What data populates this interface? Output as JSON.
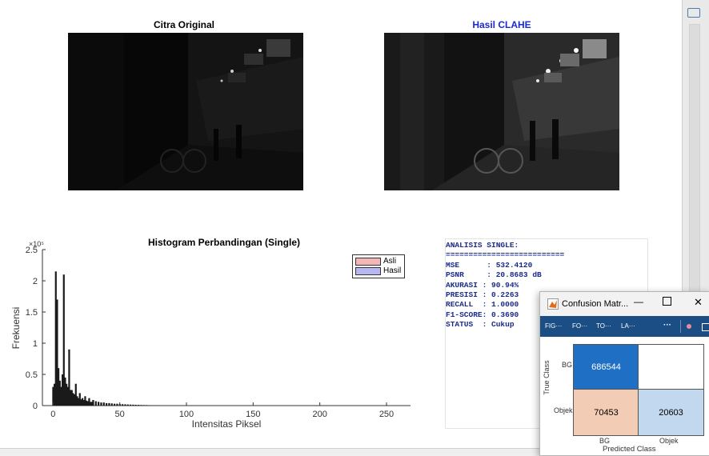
{
  "figure": {
    "title_original": "Citra Original",
    "title_clahe": "Hasil CLAHE",
    "title_clahe_color": "#1a2ad0"
  },
  "histogram": {
    "title": "Histogram Perbandingan (Single)",
    "ylabel": "Frekuensi",
    "xlabel": "Intensitas Piksel",
    "exponent": "×10⁵",
    "legend": [
      "Asli",
      "Hasil"
    ]
  },
  "chart_data": {
    "type": "bar",
    "title": "Histogram Perbandingan (Single)",
    "xlabel": "Intensitas Piksel",
    "ylabel": "Frekuensi",
    "xlim": [
      -8,
      268
    ],
    "ylim": [
      0,
      2.5
    ],
    "y_scale_label": "×10^5",
    "xticks": [
      0,
      50,
      100,
      150,
      200,
      250
    ],
    "yticks": [
      0,
      0.5,
      1,
      1.5,
      2,
      2.5
    ],
    "series": [
      {
        "name": "Asli",
        "color": "#f4b6b6"
      },
      {
        "name": "Hasil",
        "color": "#b7b7f3"
      }
    ],
    "bins": [
      [
        0,
        0.3
      ],
      [
        1,
        0.35
      ],
      [
        2,
        2.15
      ],
      [
        3,
        1.7
      ],
      [
        4,
        0.6
      ],
      [
        5,
        0.4
      ],
      [
        6,
        0.3
      ],
      [
        7,
        0.5
      ],
      [
        8,
        2.1
      ],
      [
        9,
        0.45
      ],
      [
        10,
        0.35
      ],
      [
        11,
        0.3
      ],
      [
        12,
        0.9
      ],
      [
        13,
        0.25
      ],
      [
        14,
        0.25
      ],
      [
        15,
        0.2
      ],
      [
        16,
        0.18
      ],
      [
        17,
        0.35
      ],
      [
        18,
        0.15
      ],
      [
        19,
        0.12
      ],
      [
        20,
        0.2
      ],
      [
        21,
        0.1
      ],
      [
        22,
        0.12
      ],
      [
        23,
        0.09
      ],
      [
        24,
        0.15
      ],
      [
        25,
        0.08
      ],
      [
        26,
        0.07
      ],
      [
        27,
        0.12
      ],
      [
        28,
        0.06
      ],
      [
        29,
        0.06
      ],
      [
        30,
        0.09
      ],
      [
        32,
        0.07
      ],
      [
        34,
        0.06
      ],
      [
        36,
        0.05
      ],
      [
        38,
        0.05
      ],
      [
        40,
        0.04
      ],
      [
        42,
        0.04
      ],
      [
        44,
        0.035
      ],
      [
        46,
        0.03
      ],
      [
        48,
        0.03
      ],
      [
        50,
        0.025
      ],
      [
        52,
        0.022
      ],
      [
        54,
        0.02
      ],
      [
        56,
        0.018
      ],
      [
        58,
        0.016
      ],
      [
        60,
        0.015
      ],
      [
        62,
        0.013
      ],
      [
        64,
        0.012
      ],
      [
        66,
        0.01
      ],
      [
        68,
        0.009
      ],
      [
        70,
        0.008
      ],
      [
        72,
        0.007
      ],
      [
        74,
        0.006
      ],
      [
        76,
        0.005
      ],
      [
        78,
        0.004
      ],
      [
        80,
        0.003
      ]
    ]
  },
  "analysis": {
    "lines": [
      "ANALISIS SINGLE:",
      "==========================",
      "MSE      : 532.4120",
      "PSNR     : 20.8683 dB",
      "AKURASI : 90.94%",
      "PRESISI : 0.2263",
      "RECALL  : 1.0000",
      "F1-SCORE: 0.3690",
      "STATUS  : Cukup"
    ]
  },
  "confusion_window": {
    "title": "Confusion Matr...",
    "toolbar": [
      "FIG···",
      "FO···",
      "TO···",
      "LA···",
      "···"
    ],
    "true_class_label": "True Class",
    "predicted_class_label": "Predicted Class",
    "row_labels": [
      "BG",
      "Objek"
    ],
    "col_labels": [
      "BG",
      "Objek"
    ],
    "cells": [
      {
        "value": "686544",
        "color": "#1f6fc4",
        "text_color": "#ffffff"
      },
      {
        "value": "",
        "color": "#ffffff",
        "text_color": "#000000"
      },
      {
        "value": "70453",
        "color": "#f2ccb4",
        "text_color": "#000000"
      },
      {
        "value": "20603",
        "color": "#c2d8ee",
        "text_color": "#000000"
      }
    ]
  }
}
